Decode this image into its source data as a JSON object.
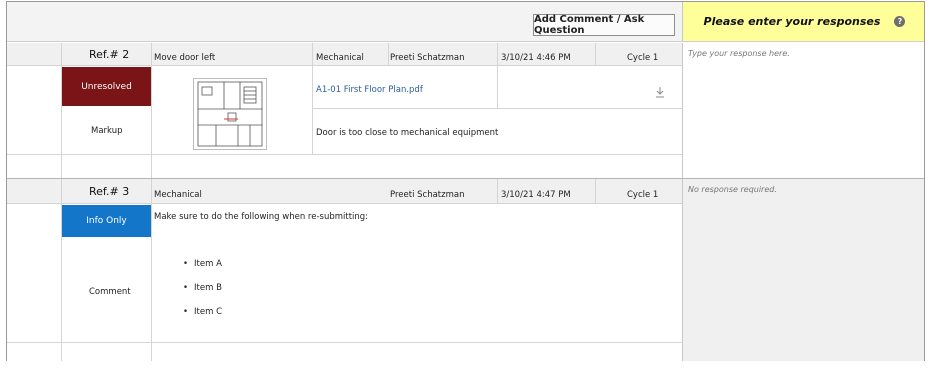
{
  "toolbar": {
    "add_button_label": "Add Comment / Ask Question"
  },
  "responses": {
    "header": "Please enter your responses",
    "help_glyph": "?"
  },
  "items": [
    {
      "ref": "Ref.# 2",
      "title": "Move door left",
      "discipline": "Mechanical",
      "author": "Preeti Schatzman",
      "timestamp": "3/10/21 4:46 PM",
      "cycle": "Cycle 1",
      "status": "Unresolved",
      "status_color": "#7b1416",
      "type": "Markup",
      "attachment": "A1-01 First Floor Plan.pdf",
      "comment": "Door is too close to mechanical equipment",
      "response_placeholder": "Type your response here."
    },
    {
      "ref": "Ref.# 3",
      "discipline": "Mechanical",
      "author": "Preeti Schatzman",
      "timestamp": "3/10/21 4:47 PM",
      "cycle": "Cycle 1",
      "status": "Info Only",
      "status_color": "#1476c8",
      "type": "Comment",
      "comment": "Make sure to do the following when re-submitting:",
      "bullets": [
        "Item A",
        "Item B",
        "Item C"
      ],
      "response_note": "No response required."
    }
  ],
  "icons": {
    "download": "download-icon",
    "thumbnail": "floor-plan-thumbnail",
    "help": "help-icon"
  }
}
